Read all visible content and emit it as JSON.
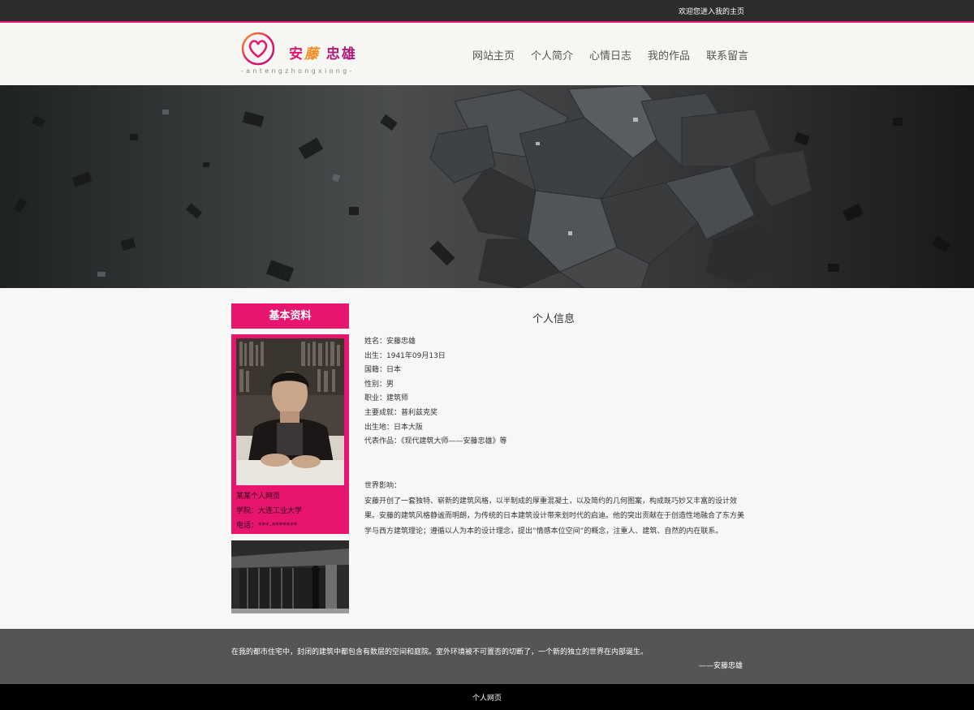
{
  "topbar": {
    "welcome": "欢迎您进入我的主页"
  },
  "brand": {
    "name_part1": "安",
    "name_part2": "藤",
    "name_part3": "忠雄",
    "pinyin": "-antengzhongxiong-",
    "accent_color": "#e8156e"
  },
  "nav": {
    "items": [
      {
        "label": "网站主页"
      },
      {
        "label": "个人简介"
      },
      {
        "label": "心情日志"
      },
      {
        "label": "我的作品"
      },
      {
        "label": "联系留言"
      }
    ]
  },
  "sidebar": {
    "title": "基本资料",
    "info": {
      "line1": "某某个人网页",
      "line2": "学院：大连工业大学",
      "line3": "电话：***-*******"
    }
  },
  "main": {
    "title": "个人信息",
    "details": [
      "姓名：安藤忠雄",
      "出生：1941年09月13日",
      "国籍：日本",
      "性别：男",
      "职业：建筑师",
      "主要成就：普利兹克奖",
      "出生地：日本大阪",
      "代表作品：《现代建筑大师——安藤忠雄》等"
    ],
    "influence_heading": "世界影响：",
    "influence_lines": [
      "安藤开创了一套独特、崭新的建筑风格，以半制成的厚重混凝土，以及简约的几何图案，构成既巧妙又丰富的设计效",
      "果。安藤的建筑风格静谧而明朗，为传统的日本建筑设计带来划时代的启迪。他的突出贡献在于创造性地融合了东方美",
      "学与西方建筑理论；遵循以人为本的设计理念，提出“情感本位空间”的概念，注重人、建筑、自然的内在联系。"
    ]
  },
  "quote": {
    "text": "在我的都市住宅中，封闭的建筑中都包含有数层的空间和庭院。室外环境被不可置否的切断了，一个新的独立的世界在内部诞生。",
    "author": "——安藤忠雄"
  },
  "footer": {
    "text": "个人网页"
  }
}
